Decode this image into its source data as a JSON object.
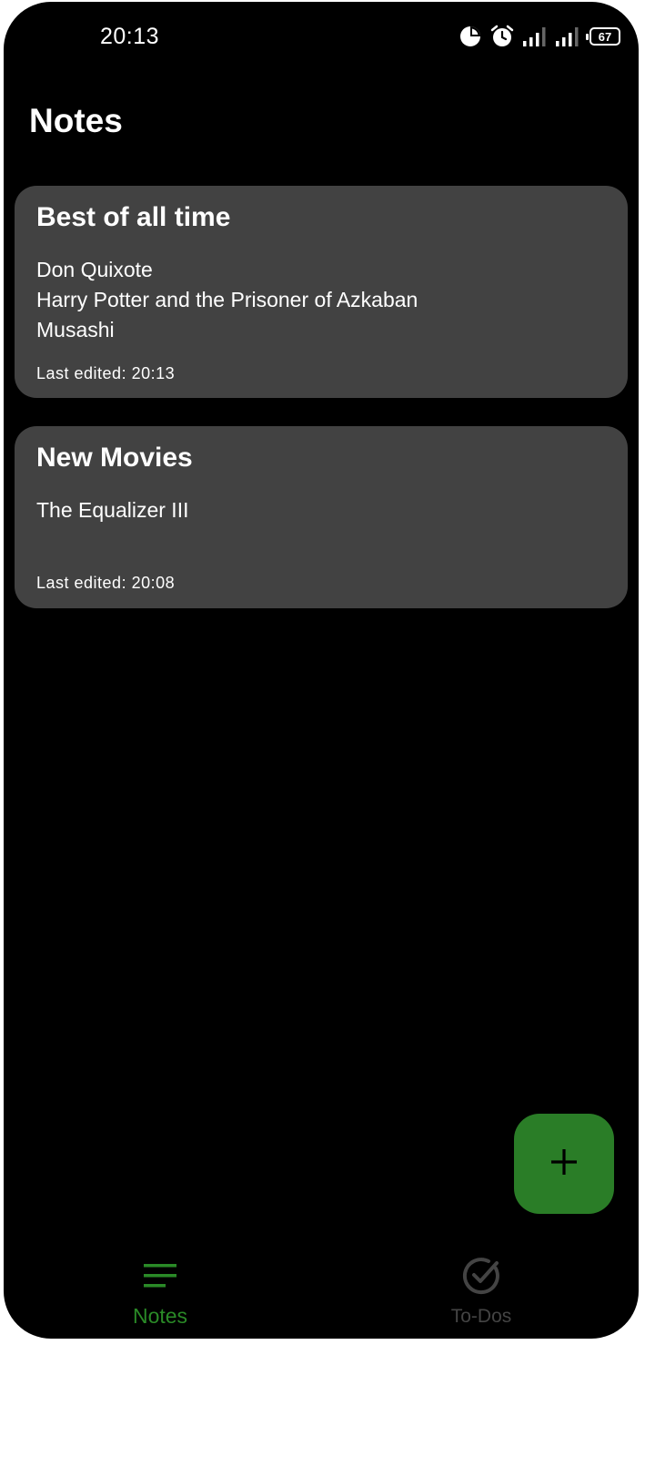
{
  "status_bar": {
    "time": "20:13",
    "icons": [
      "data-saver-icon",
      "alarm-icon",
      "signal-icon",
      "signal-icon",
      "battery-icon"
    ],
    "battery_level": "67"
  },
  "header": {
    "title": "Notes"
  },
  "notes": [
    {
      "title": "Best of all time",
      "lines": [
        "Don Quixote",
        "Harry Potter and the Prisoner of Azkaban",
        "Musashi"
      ],
      "edited": "Last edited: 20:13"
    },
    {
      "title": "New Movies",
      "lines": [
        "The Equalizer III"
      ],
      "edited": "Last edited: 20:08"
    }
  ],
  "fab": {
    "icon": "plus-icon"
  },
  "bottom_nav": {
    "items": [
      {
        "label": "Notes",
        "icon": "list-icon",
        "active": true
      },
      {
        "label": "To-Dos",
        "icon": "check-circle-icon",
        "active": false
      }
    ]
  },
  "colors": {
    "background": "#000000",
    "card": "#424242",
    "accent": "#2a7d27",
    "inactive": "#444444",
    "text": "#ffffff"
  }
}
